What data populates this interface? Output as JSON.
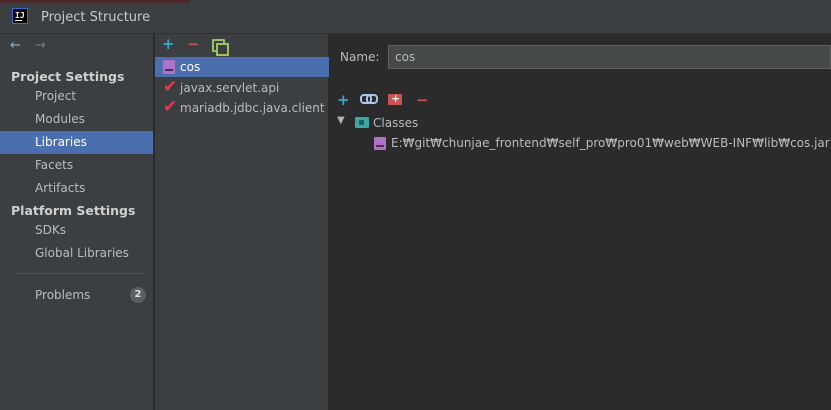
{
  "window": {
    "title": "Project Structure",
    "app_icon_text": "IJ"
  },
  "nav": {
    "back_icon": "←",
    "forward_icon": "→"
  },
  "sidebar": {
    "project_settings_header": "Project Settings",
    "project_settings_items": [
      {
        "label": "Project"
      },
      {
        "label": "Modules"
      },
      {
        "label": "Libraries",
        "selected": true
      },
      {
        "label": "Facets"
      },
      {
        "label": "Artifacts"
      }
    ],
    "platform_settings_header": "Platform Settings",
    "platform_settings_items": [
      {
        "label": "SDKs"
      },
      {
        "label": "Global Libraries"
      }
    ],
    "problems": {
      "label": "Problems",
      "count": "2"
    }
  },
  "library_list": {
    "toolbar": {
      "add": "+",
      "remove": "−"
    },
    "items": [
      {
        "label": "cos",
        "icon": "jar-icon",
        "selected": true
      },
      {
        "label": "javax.servlet.api",
        "icon": "maven-check-icon"
      },
      {
        "label": "mariadb.jdbc.java.client",
        "icon": "maven-check-icon"
      }
    ]
  },
  "detail": {
    "name_label": "Name:",
    "name_value": "cos",
    "toolbar": {
      "add": "+",
      "remove": "−"
    },
    "classes_node": "Classes",
    "class_path": "E:₩git₩chunjae_frontend₩self_pro₩pro01₩web₩WEB-INF₩lib₩cos.jar"
  },
  "colors": {
    "selection": "#4b6eaf",
    "panel": "#3c3f41",
    "content": "#2b2b2b",
    "accent_add": "#3fa5c7",
    "accent_remove": "#c75450"
  }
}
